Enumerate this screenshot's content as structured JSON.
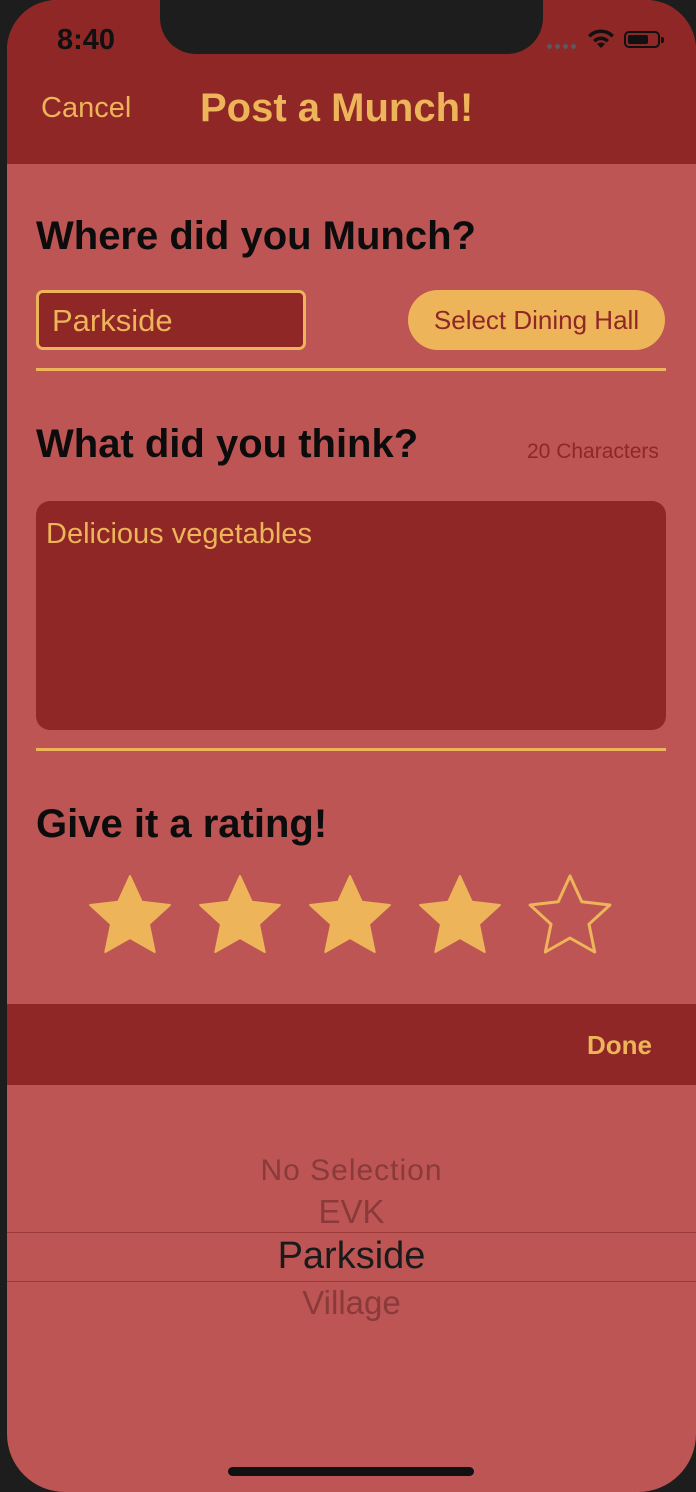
{
  "status_bar": {
    "time": "8:40"
  },
  "nav": {
    "cancel_label": "Cancel",
    "title": "Post a Munch!"
  },
  "where": {
    "title": "Where did you Munch?",
    "field_value": "Parkside",
    "select_button_label": "Select Dining Hall"
  },
  "review": {
    "title": "What did you think?",
    "char_count": "20 Characters",
    "text": "Delicious vegetables"
  },
  "rating": {
    "title": "Give it a rating!",
    "value": 4,
    "max": 5
  },
  "picker": {
    "done_label": "Done",
    "options": [
      "No Selection",
      "EVK",
      "Parkside",
      "Village"
    ],
    "selected": "Parkside"
  },
  "colors": {
    "nav_background": "#8e2726",
    "content_background": "#bd5554",
    "accent": "#edb45a",
    "field_background": "#8e2726"
  }
}
